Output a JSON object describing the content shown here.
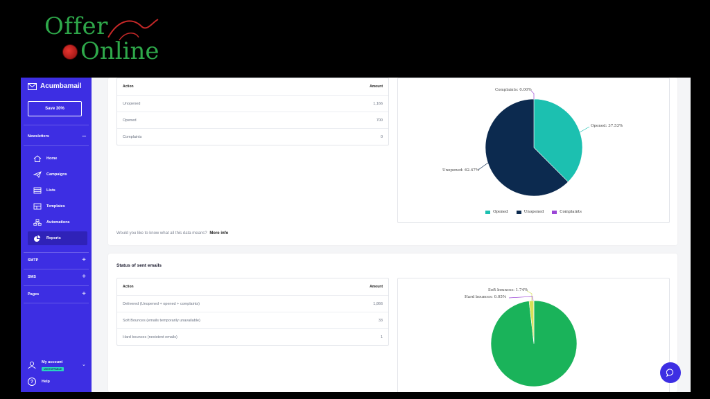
{
  "logo": {
    "line1": "Offer",
    "line2": "Online"
  },
  "sidebar": {
    "brand": "Acumbamail",
    "save_button": "Save 30%",
    "sections": {
      "newsletters": "Newsletters",
      "smtp": "SMTP",
      "sms": "SMS",
      "pages": "Pages"
    },
    "items": [
      {
        "label": "Home",
        "icon": "home-icon"
      },
      {
        "label": "Campaigns",
        "icon": "paper-plane-icon"
      },
      {
        "label": "Lists",
        "icon": "lists-icon"
      },
      {
        "label": "Templates",
        "icon": "templates-icon"
      },
      {
        "label": "Automations",
        "icon": "automations-icon"
      },
      {
        "label": "Reports",
        "icon": "reports-icon",
        "active": true
      }
    ],
    "account": {
      "label": "My account",
      "badge": "UNSTOPPABLE"
    },
    "help": "Help"
  },
  "opens": {
    "table": {
      "headers": {
        "action": "Action",
        "amount": "Amount"
      },
      "rows": [
        {
          "action": "Unopened",
          "amount": "1,166"
        },
        {
          "action": "Opened",
          "amount": "700"
        },
        {
          "action": "Complaints",
          "amount": "0"
        }
      ]
    },
    "more_info_text": "Would you like to know what all this data means?",
    "more_info_link": "More info"
  },
  "sent": {
    "title": "Status of sent emails",
    "table": {
      "headers": {
        "action": "Action",
        "amount": "Amount"
      },
      "rows": [
        {
          "action": "Delivered (Unopened + opened + complaints)",
          "amount": "1,866"
        },
        {
          "action": "Soft Bounces (emails temporarily unavailable)",
          "amount": "33"
        },
        {
          "action": "Hard bounces (nexistent emails)",
          "amount": "1"
        }
      ]
    }
  },
  "chart_data": [
    {
      "type": "pie",
      "categories": [
        "Opened",
        "Unopened",
        "Complaints"
      ],
      "values": [
        37.53,
        62.47,
        0.0
      ],
      "colors": [
        "#1cc0b0",
        "#0c2a4f",
        "#9b45d6"
      ],
      "labels": [
        "Opened: 37.53%",
        "Unopened: 62.47%",
        "Complaints: 0.00%"
      ],
      "legend": "bottom"
    },
    {
      "type": "pie",
      "categories": [
        "Delivered",
        "Soft bounces",
        "Hard bounces"
      ],
      "values": [
        98.2,
        1.74,
        0.05
      ],
      "colors": [
        "#1ab35a",
        "#d4e157",
        "#9b45d6"
      ],
      "labels": [
        "Soft bounces: 1.74%",
        "Hard bounces: 0.05%"
      ]
    }
  ]
}
